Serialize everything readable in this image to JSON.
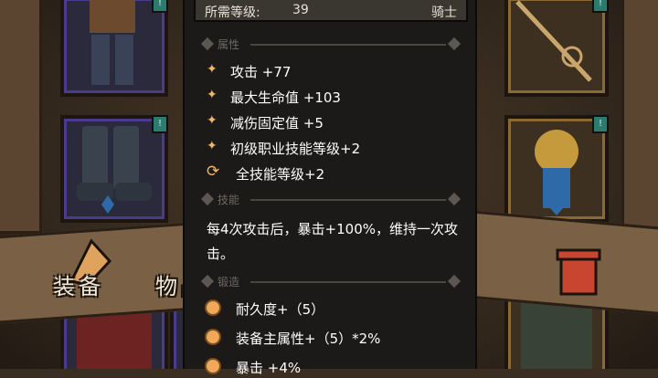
{
  "required_level": {
    "label": "所需等级:",
    "value": "39",
    "class": "骑士"
  },
  "sections": {
    "attributes": "属性",
    "skills": "技能",
    "forge": "锻造"
  },
  "stats": [
    {
      "icon": "star-sparkle-icon",
      "text": "攻击 +77"
    },
    {
      "icon": "star-sparkle-icon",
      "text": "最大生命值 +103"
    },
    {
      "icon": "star-sparkle-icon",
      "text": "减伤固定值 +5"
    },
    {
      "icon": "star-sparkle-icon",
      "text": "初级职业技能等级+2"
    },
    {
      "icon": "cycle-arrows-icon",
      "text": "全技能等级+2"
    }
  ],
  "skill_description": "每4次攻击后，暴击+100%，维持一次攻击。",
  "forge_stats": [
    {
      "text": "耐久度+（5）"
    },
    {
      "text": "装备主属性+（5）*2%"
    },
    {
      "text": "暴击 +4%"
    }
  ],
  "tabs": {
    "equipment": "装备",
    "items": "物品"
  },
  "slot_badges": [
    "!",
    "!",
    "!",
    "!"
  ],
  "colors": {
    "accent": "#f2b66a",
    "panel": "#1c1a18",
    "slot_border": "#4a3b8c"
  }
}
